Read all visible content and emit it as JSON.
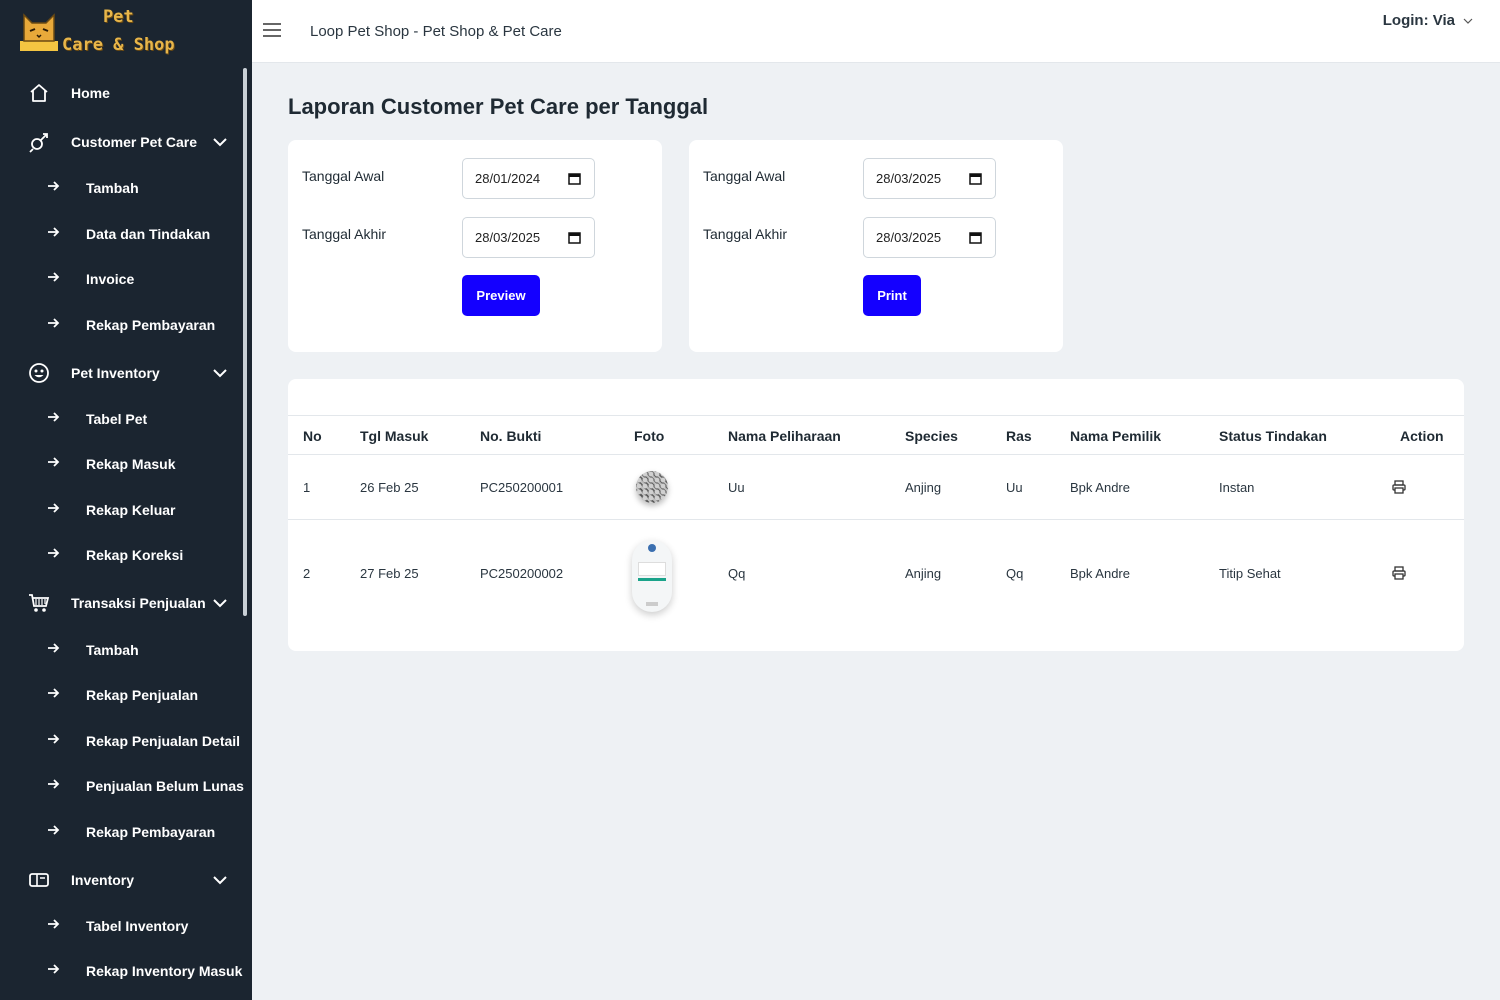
{
  "logo": {
    "line1": "Pet",
    "line2": "Care & Shop"
  },
  "sidebar": {
    "home": "Home",
    "customer_pet_care": {
      "label": "Customer Pet Care",
      "items": [
        "Tambah",
        "Data dan Tindakan",
        "Invoice",
        "Rekap Pembayaran"
      ]
    },
    "pet_inventory": {
      "label": "Pet Inventory",
      "items": [
        "Tabel Pet",
        "Rekap Masuk",
        "Rekap Keluar",
        "Rekap Koreksi"
      ]
    },
    "transaksi_penjualan": {
      "label": "Transaksi Penjualan",
      "items": [
        "Tambah",
        "Rekap Penjualan",
        "Rekap Penjualan Detail",
        "Penjualan Belum Lunas",
        "Rekap Pembayaran"
      ]
    },
    "inventory": {
      "label": "Inventory",
      "items": [
        "Tabel Inventory",
        "Rekap Inventory Masuk"
      ]
    }
  },
  "topbar": {
    "title": "Loop Pet Shop - Pet Shop & Pet Care",
    "login": "Login: Via"
  },
  "page_title": "Laporan Customer Pet Care per Tanggal",
  "preview_card": {
    "start_label": "Tanggal Awal",
    "start_value": "28/01/2024",
    "end_label": "Tanggal Akhir",
    "end_value": "28/03/2025",
    "button": "Preview"
  },
  "print_card": {
    "start_label": "Tanggal Awal",
    "start_value": "28/03/2025",
    "end_label": "Tanggal Akhir",
    "end_value": "28/03/2025",
    "button": "Print"
  },
  "table": {
    "headers": [
      "No",
      "Tgl Masuk",
      "No. Bukti",
      "Foto",
      "Nama Peliharaan",
      "Species",
      "Ras",
      "Nama Pemilik",
      "Status Tindakan",
      "Action"
    ],
    "rows": [
      {
        "no": "1",
        "tgl": "26 Feb 25",
        "bukti": "PC250200001",
        "nama": "Uu",
        "species": "Anjing",
        "ras": "Uu",
        "pemilik": "Bpk Andre",
        "status": "Instan"
      },
      {
        "no": "2",
        "tgl": "27 Feb 25",
        "bukti": "PC250200002",
        "nama": "Qq",
        "species": "Anjing",
        "ras": "Qq",
        "pemilik": "Bpk Andre",
        "status": "Titip Sehat"
      }
    ]
  },
  "colors": {
    "sidebar_bg": "#1b2530",
    "primary_button": "#1400ff",
    "page_bg": "#eef1f4"
  },
  "icons": [
    "home-icon",
    "pet-gender-icon",
    "smiley-icon",
    "cart-icon",
    "inventory-box-icon",
    "arrow-right-icon",
    "chevron-down-icon",
    "hamburger-icon",
    "calendar-icon",
    "printer-icon"
  ]
}
